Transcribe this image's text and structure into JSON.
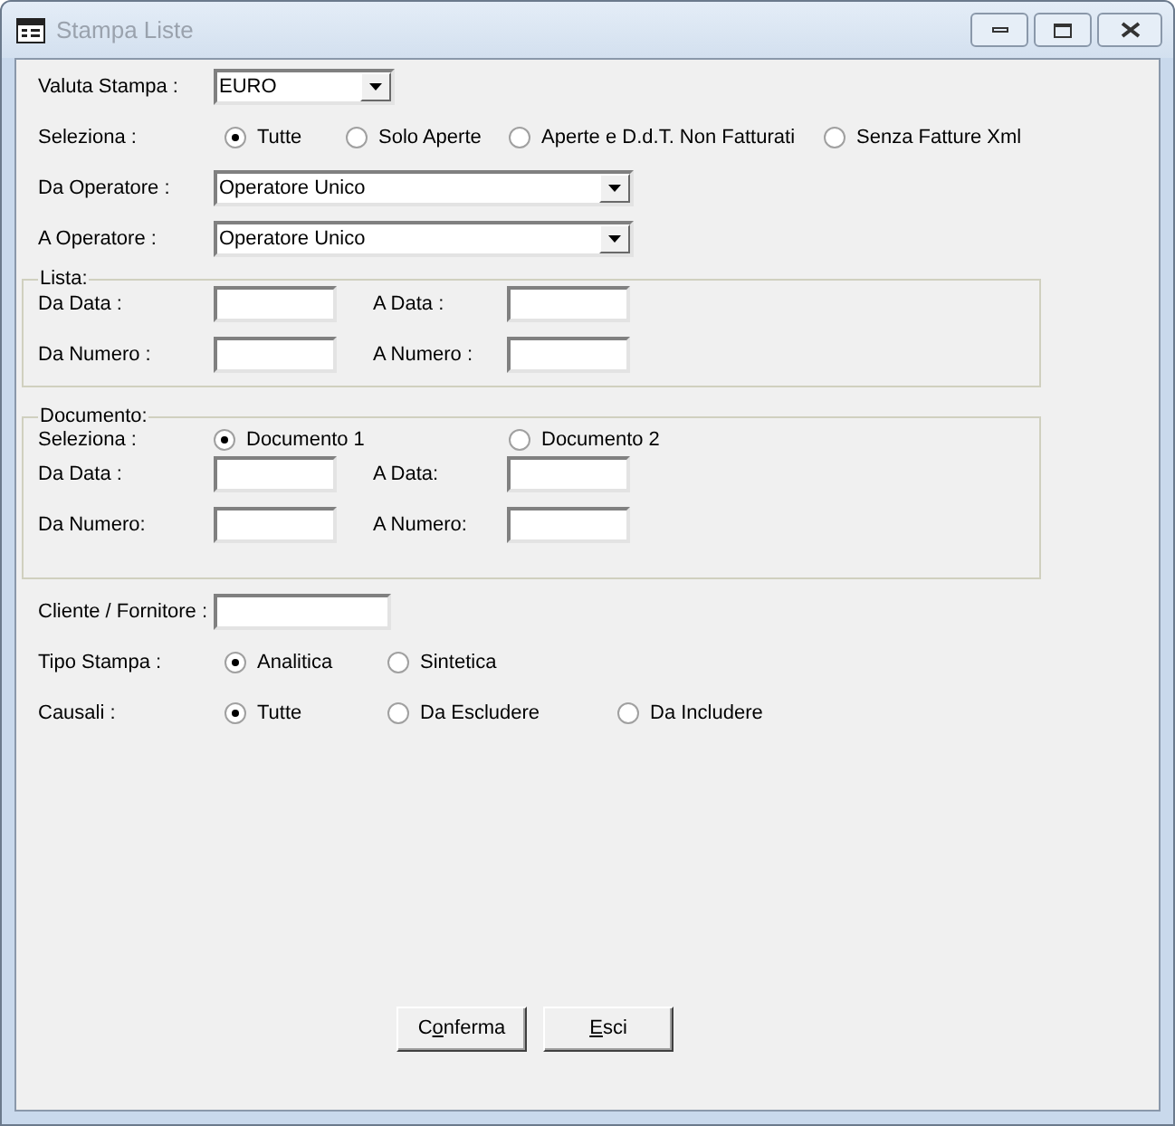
{
  "window": {
    "title": "Stampa Liste"
  },
  "valuta": {
    "label": "Valuta Stampa :",
    "value": "EURO"
  },
  "seleziona": {
    "label": "Seleziona :",
    "options": [
      {
        "label": "Tutte",
        "selected": true
      },
      {
        "label": "Solo Aperte",
        "selected": false
      },
      {
        "label": "Aperte e D.d.T. Non Fatturati",
        "selected": false
      },
      {
        "label": "Senza Fatture Xml",
        "selected": false
      }
    ]
  },
  "da_operatore": {
    "label": "Da Operatore :",
    "value": "Operatore Unico"
  },
  "a_operatore": {
    "label": "A Operatore :",
    "value": "Operatore Unico"
  },
  "lista": {
    "title": "Lista:",
    "fields": [
      {
        "label": "Da Data :"
      },
      {
        "label": "A Data :"
      },
      {
        "label": "Da Numero :"
      },
      {
        "label": "A Numero :"
      }
    ]
  },
  "documento": {
    "title": "Documento:",
    "seleziona": {
      "label": "Seleziona :",
      "options": [
        {
          "label": "Documento 1",
          "selected": true
        },
        {
          "label": "Documento 2",
          "selected": false
        }
      ]
    },
    "fields": [
      {
        "label": "Da Data :"
      },
      {
        "label": "A Data:"
      },
      {
        "label": "Da Numero:"
      },
      {
        "label": "A Numero:"
      }
    ]
  },
  "cliente_fornitore": {
    "label": "Cliente / Fornitore :"
  },
  "tipo_stampa": {
    "label": "Tipo Stampa :",
    "options": [
      {
        "label": "Analitica",
        "selected": true
      },
      {
        "label": "Sintetica",
        "selected": false
      }
    ]
  },
  "causali": {
    "label": "Causali :",
    "options": [
      {
        "label": "Tutte",
        "selected": true
      },
      {
        "label": "Da Escludere",
        "selected": false
      },
      {
        "label": "Da Includere",
        "selected": false
      }
    ]
  },
  "buttons": [
    {
      "label_before": "C",
      "mnemonic": "o",
      "label_after": "nferma"
    },
    {
      "mnemonic": "E",
      "label_after": "sci"
    }
  ]
}
